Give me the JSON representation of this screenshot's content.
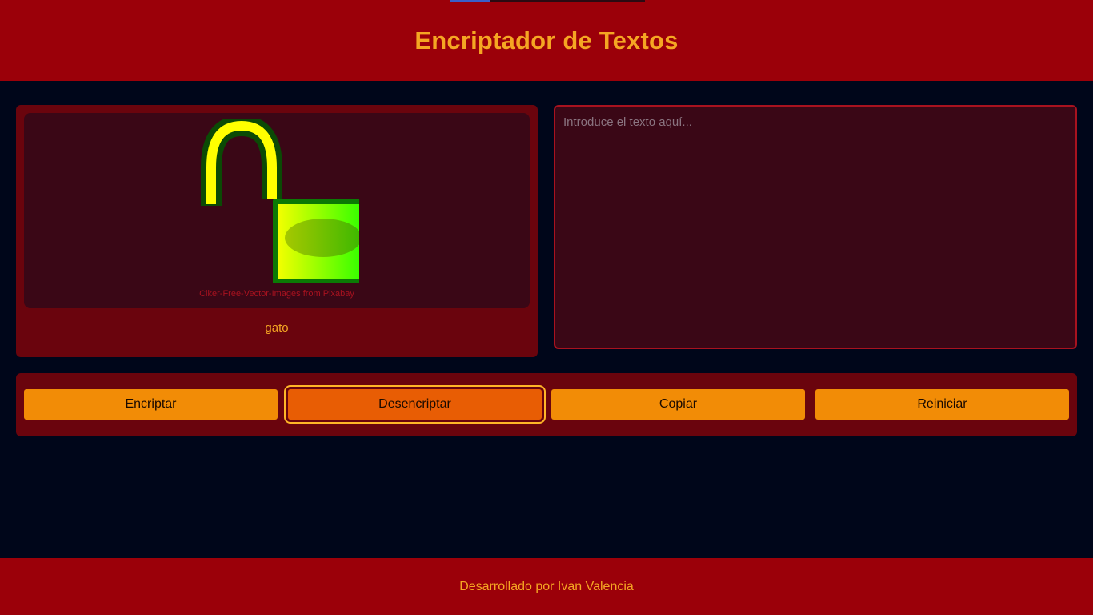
{
  "header": {
    "title": "Encriptador de Textos"
  },
  "left_panel": {
    "image_icon": "unlocked-padlock",
    "image_credit": "Clker-Free-Vector-Images from Pixabay",
    "message": "gato"
  },
  "editor": {
    "value": "",
    "placeholder": "Introduce el texto aquí..."
  },
  "buttons": {
    "encrypt": "Encriptar",
    "decrypt": "Desencriptar",
    "copy": "Copiar",
    "reset": "Reiniciar"
  },
  "footer": {
    "text": "Desarrollado por Ivan Valencia"
  },
  "colors": {
    "header_bg": "#9b0009",
    "page_bg": "#00061a",
    "accent": "#f5a623",
    "button": "#f28c06",
    "button_active": "#e85d04"
  }
}
